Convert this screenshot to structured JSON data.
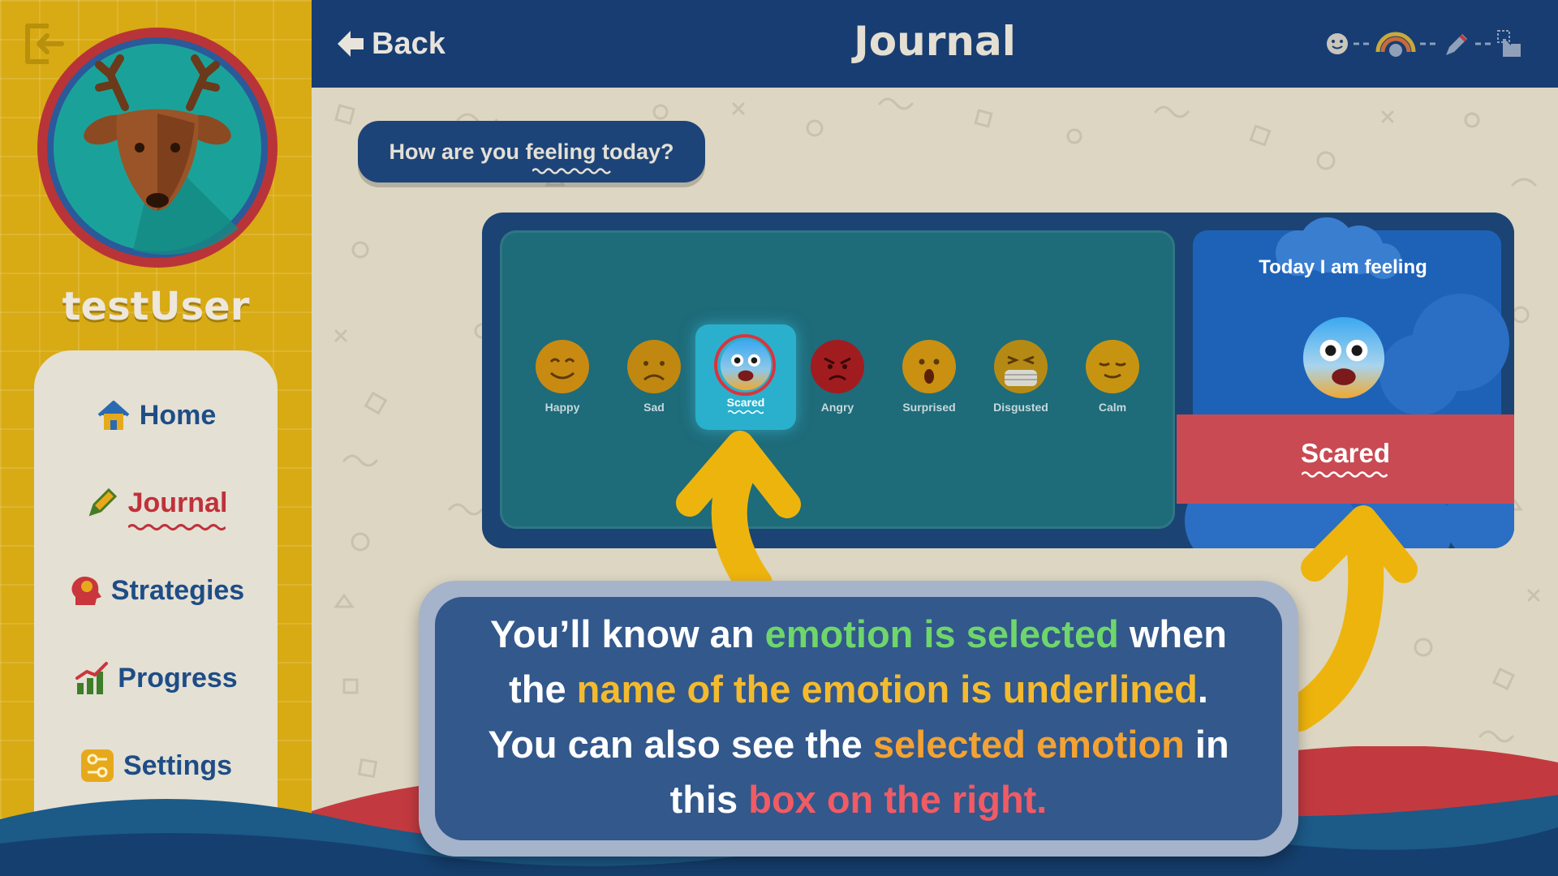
{
  "user": {
    "name": "testUser"
  },
  "header": {
    "back_label": "Back",
    "title": "Journal"
  },
  "sidebar": {
    "items": [
      {
        "label": "Home",
        "icon": "home-icon"
      },
      {
        "label": "Journal",
        "icon": "pencil-icon",
        "active": true
      },
      {
        "label": "Strategies",
        "icon": "head-icon"
      },
      {
        "label": "Progress",
        "icon": "chart-icon"
      },
      {
        "label": "Settings",
        "icon": "sliders-icon"
      }
    ]
  },
  "steps": [
    "emoji-icon",
    "rainbow-icon",
    "pencil-icon",
    "touch-icon"
  ],
  "question": "How are you feeling today?",
  "emotions": [
    {
      "label": "Happy",
      "color": "#c98a12"
    },
    {
      "label": "Sad",
      "color": "#c08810"
    },
    {
      "label": "Scared",
      "color": "#2aa8e8",
      "selected": true
    },
    {
      "label": "Angry",
      "color": "#a11c1f"
    },
    {
      "label": "Surprised",
      "color": "#c99012"
    },
    {
      "label": "Disgusted",
      "color": "#b58a14"
    },
    {
      "label": "Calm",
      "color": "#c79412"
    }
  ],
  "selected_box": {
    "heading": "Today I am feeling",
    "emotion": "Scared"
  },
  "tooltip": {
    "line1_a": "You’ll know an ",
    "line1_b": "emotion is selected",
    "line1_c": " when",
    "line2_a": "the ",
    "line2_b": "name of the emotion is underlined",
    "line2_c": ".",
    "line3_a": "You can also see the ",
    "line3_b": "selected emotion",
    "line3_c": " in",
    "line4_a": "this ",
    "line4_b": "box on the right."
  },
  "colors": {
    "header": "#173d72",
    "sidebar": "#d8aa14",
    "accent_red": "#c94a53",
    "highlight_green": "#6fd66b",
    "highlight_yellow": "#f4ba2e",
    "highlight_red": "#f05b64"
  }
}
